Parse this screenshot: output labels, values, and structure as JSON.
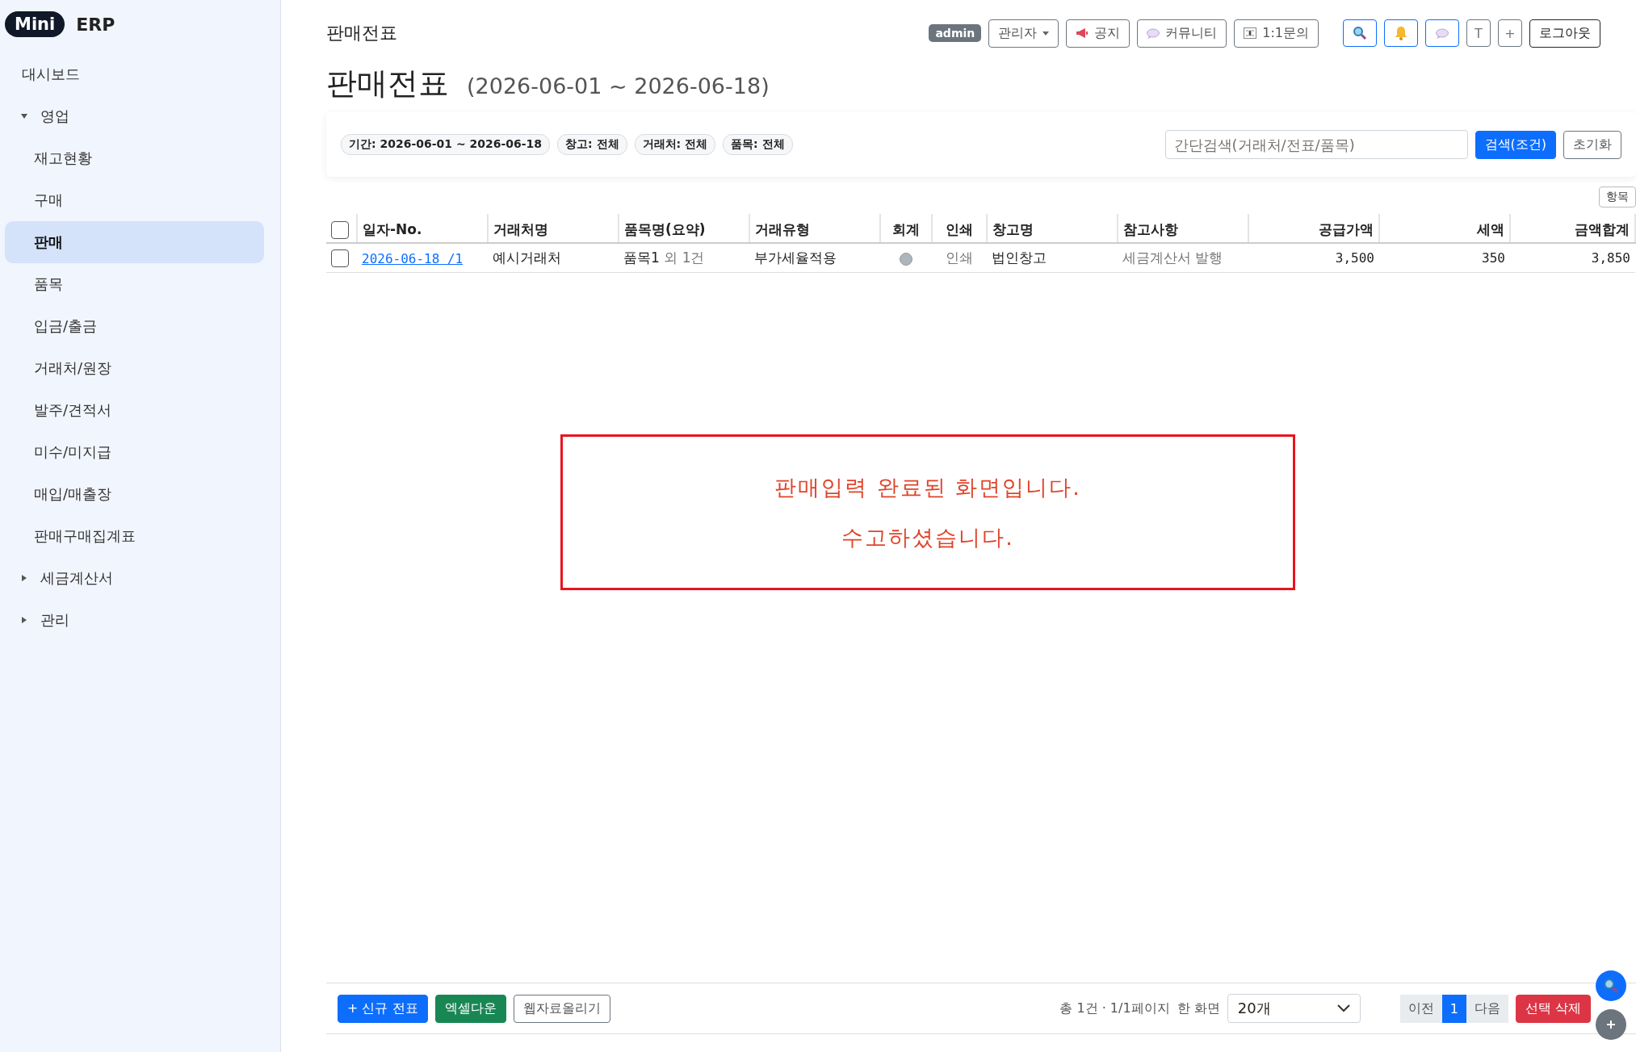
{
  "brand": {
    "badge": "Mini",
    "name": "ERP"
  },
  "sidebar": {
    "items": [
      {
        "kind": "link",
        "label": "대시보드",
        "selected": false
      },
      {
        "kind": "group",
        "label": "영업",
        "expanded": true,
        "children": [
          {
            "label": "재고현황",
            "selected": false
          },
          {
            "label": "구매",
            "selected": false
          },
          {
            "label": "판매",
            "selected": true
          },
          {
            "label": "품목",
            "selected": false
          },
          {
            "label": "입금/출금",
            "selected": false
          },
          {
            "label": "거래처/원장",
            "selected": false
          },
          {
            "label": "발주/견적서",
            "selected": false
          },
          {
            "label": "미수/미지급",
            "selected": false
          },
          {
            "label": "매입/매출장",
            "selected": false
          },
          {
            "label": "판매구매집계표",
            "selected": false
          }
        ]
      },
      {
        "kind": "group",
        "label": "세금계산서",
        "expanded": false
      },
      {
        "kind": "group",
        "label": "관리",
        "expanded": false
      }
    ]
  },
  "header": {
    "breadcrumb": "판매전표",
    "user_badge": "admin",
    "user_menu": "관리자",
    "buttons": [
      {
        "kind": "notice",
        "label": "공지"
      },
      {
        "kind": "community",
        "label": "커뮤니티"
      },
      {
        "kind": "inquiry",
        "label": "1:1문의"
      }
    ],
    "icon_buttons": [
      {
        "kind": "search"
      },
      {
        "kind": "bell"
      },
      {
        "kind": "chat"
      },
      {
        "kind": "text",
        "label": "T"
      },
      {
        "kind": "text",
        "label": "+"
      }
    ],
    "logout": "로그아웃"
  },
  "page": {
    "title": "판매전표",
    "period": "(2026-06-01 ~ 2026-06-18)"
  },
  "filters": {
    "chips": [
      "기간: 2026-06-01 ~ 2026-06-18",
      "창고: 전체",
      "거래처: 전체",
      "품목: 전체"
    ],
    "search": {
      "placeholder": "간단검색(거래처/전표/품목)"
    },
    "search_button": "검색(조건)",
    "reset_button": "초기화"
  },
  "columns_button": "항목",
  "table": {
    "all_checked": false,
    "columns": [
      "일자-No.",
      "거래처명",
      "품목명(요약)",
      "거래유형",
      "회계",
      "인쇄",
      "창고명",
      "참고사항",
      "공급가액",
      "세액",
      "금액합계"
    ],
    "rows": [
      {
        "checked": false,
        "date_no": "2026-06-18 /1",
        "customer": "예시거래처",
        "item": "품목1",
        "item_extra": "외 1건",
        "trade_type": "부가세율적용",
        "posted": false,
        "print": "인쇄",
        "warehouse": "법인창고",
        "note": "세금계산서 발행",
        "supply": "3,500",
        "tax": "350",
        "total": "3,850"
      }
    ]
  },
  "notice": {
    "lines": [
      "판매입력 완료된 화면입니다.",
      "수고하셨습니다."
    ]
  },
  "footer": {
    "new_button": "+ 신규 전표",
    "excel_button": "엑셀다운",
    "upload_button": "웹자료올리기",
    "summary": "총 1건 · 1/1페이지",
    "page_size_label": "한 화면",
    "page_size": "20개",
    "pagination": {
      "prev": "이전",
      "pages": [
        {
          "label": "1",
          "selected": true
        }
      ],
      "next": "다음"
    },
    "delete_button": "선택 삭제"
  }
}
